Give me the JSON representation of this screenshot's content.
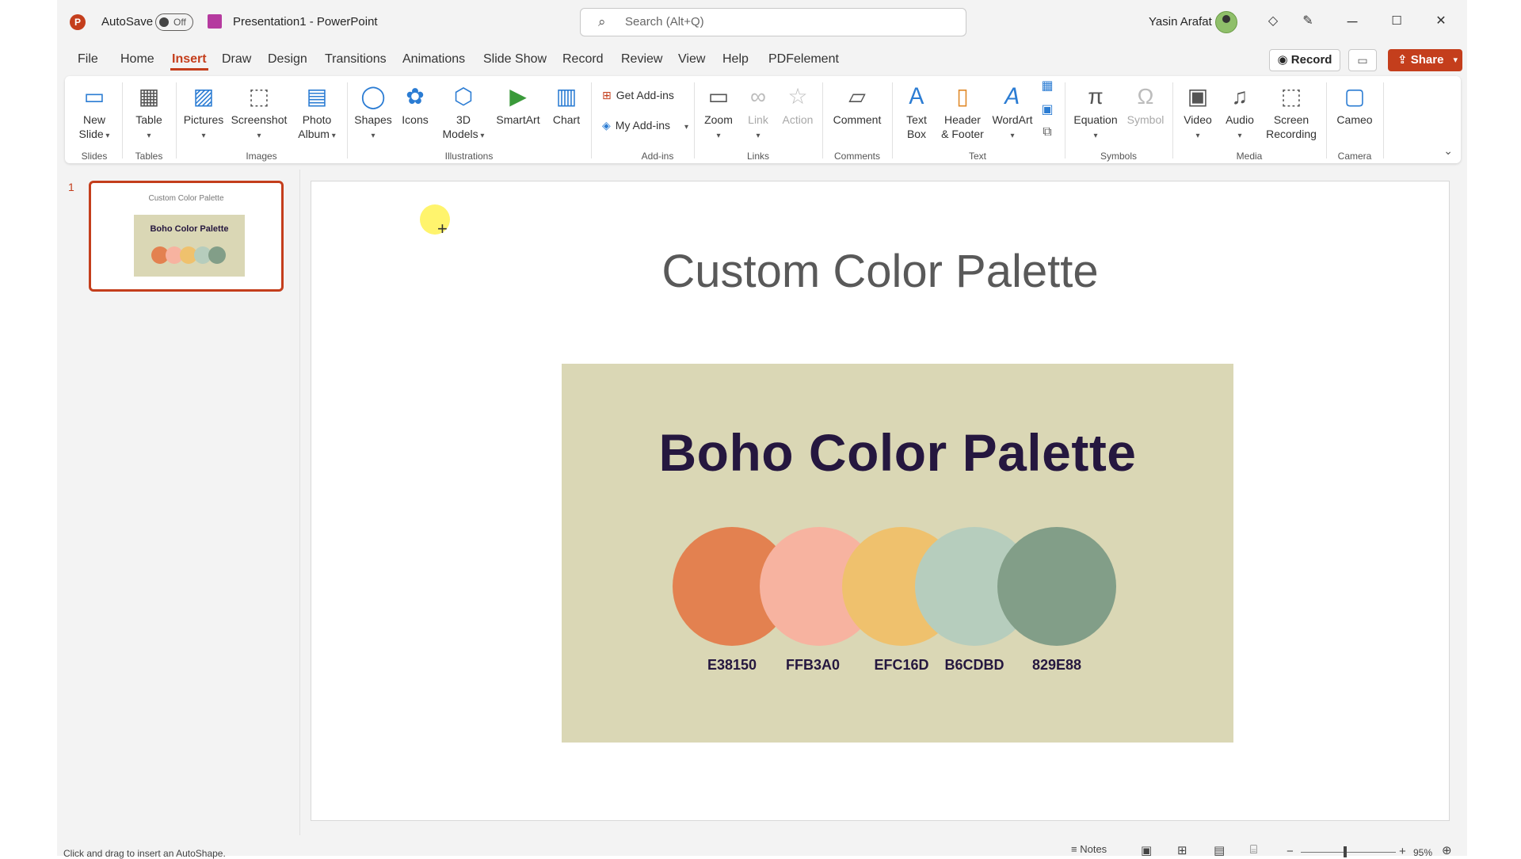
{
  "titlebar": {
    "app_logo": "P",
    "autosave_label": "AutoSave",
    "autosave_state": "Off",
    "document_title": "Presentation1  -  PowerPoint",
    "search_placeholder": "Search (Alt+Q)",
    "user_name": "Yasin Arafat"
  },
  "window_controls": {
    "minimize": "─",
    "maximize": "☐",
    "close": "✕"
  },
  "tabs": [
    "File",
    "Home",
    "Insert",
    "Draw",
    "Design",
    "Transitions",
    "Animations",
    "Slide Show",
    "Record",
    "Review",
    "View",
    "Help",
    "PDFelement"
  ],
  "active_tab": "Insert",
  "actions": {
    "record": "Record",
    "share": "Share"
  },
  "ribbon": {
    "groups": {
      "slides": "Slides",
      "tables": "Tables",
      "images": "Images",
      "illustrations": "Illustrations",
      "addins": "Add-ins",
      "links": "Links",
      "comments": "Comments",
      "text": "Text",
      "symbols": "Symbols",
      "media": "Media",
      "camera": "Camera"
    },
    "items": {
      "new_slide": "New\nSlide",
      "table": "Table",
      "pictures": "Pictures",
      "screenshot": "Screenshot",
      "photo_album": "Photo\nAlbum",
      "shapes": "Shapes",
      "icons": "Icons",
      "models_3d": "3D\nModels",
      "smartart": "SmartArt",
      "chart": "Chart",
      "get_addins": "Get Add-ins",
      "my_addins": "My Add-ins",
      "zoom": "Zoom",
      "link": "Link",
      "action": "Action",
      "comment": "Comment",
      "text_box": "Text\nBox",
      "header_footer": "Header\n& Footer",
      "wordart": "WordArt",
      "equation": "Equation",
      "symbol": "Symbol",
      "video": "Video",
      "audio": "Audio",
      "screen_recording": "Screen\nRecording",
      "cameo": "Cameo"
    }
  },
  "thumbnails": [
    {
      "number": "1",
      "title": "Custom Color Palette",
      "image_title": "Boho Color Palette"
    }
  ],
  "slide": {
    "title": "Custom Color Palette",
    "palette_title": "Boho Color Palette",
    "swatches": [
      {
        "label": "E38150",
        "color": "#e38150"
      },
      {
        "label": "FFB3A0",
        "color": "#f7b3a0"
      },
      {
        "label": "EFC16D",
        "color": "#efc16d"
      },
      {
        "label": "B6CDBD",
        "color": "#b6cdbd"
      },
      {
        "label": "829E88",
        "color": "#829e88"
      }
    ],
    "image_bg": "#dad7b5",
    "title_color": "#25173f"
  },
  "statusbar": {
    "message": "Click and drag to insert an AutoShape.",
    "notes": "Notes",
    "zoom": "95%"
  },
  "colors": {
    "accent": "#c43e1c"
  }
}
